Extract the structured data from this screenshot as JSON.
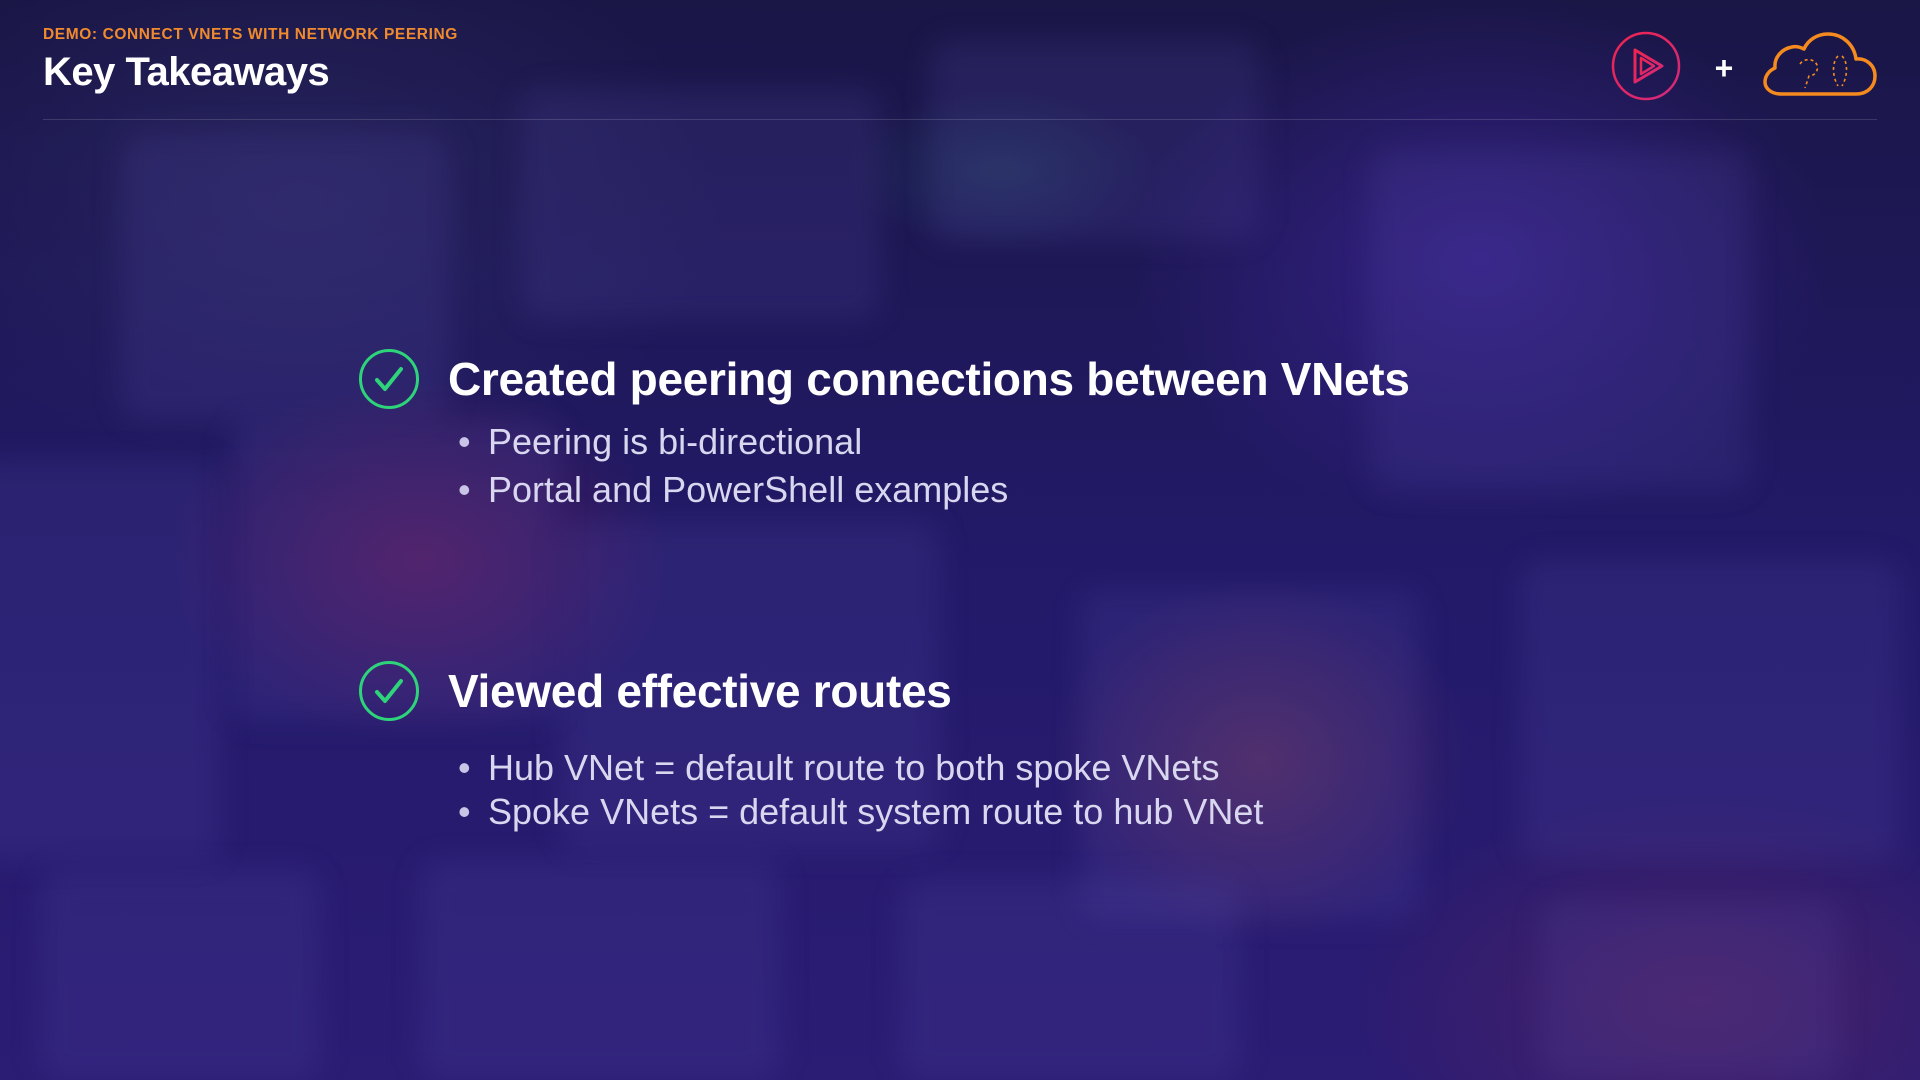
{
  "header": {
    "eyebrow": "DEMO: CONNECT VNETS WITH NETWORK PEERING",
    "title": "Key Takeaways"
  },
  "logos": {
    "left_icon": "play-circle-icon",
    "separator": "+",
    "right_icon": "cloud-icon",
    "pluralsight_color": "#e0245e",
    "cloud_color": "#f58a1f"
  },
  "sections": [
    {
      "icon": "check-circle-icon",
      "heading": "Created peering connections between VNets",
      "bullets": [
        "Peering is bi-directional",
        "Portal and PowerShell examples"
      ]
    },
    {
      "icon": "check-circle-icon",
      "heading": "Viewed effective routes",
      "bullets": [
        "Hub VNet = default route to both spoke VNets",
        "Spoke VNets = default system route to hub VNet"
      ]
    }
  ],
  "colors": {
    "accent_orange": "#f08a2e",
    "check_green": "#2ed47a",
    "background": "#1d1658"
  }
}
